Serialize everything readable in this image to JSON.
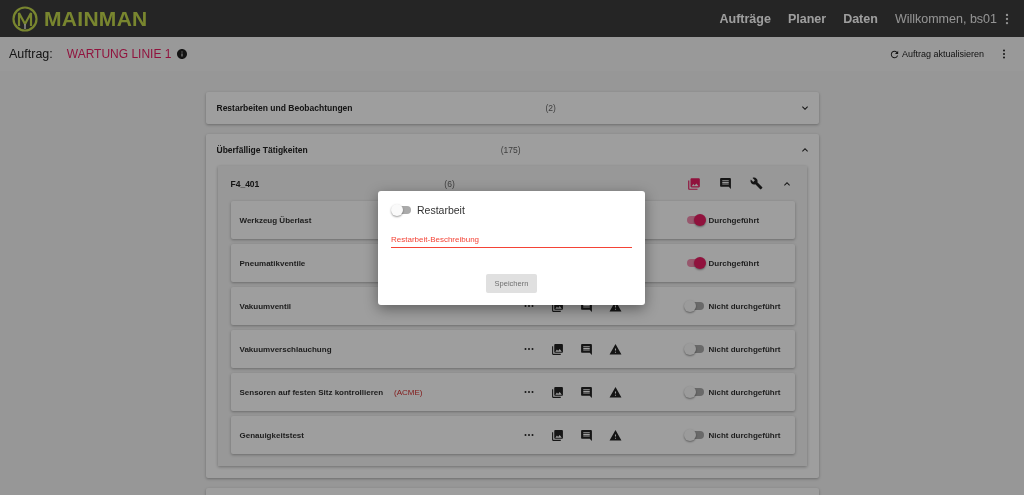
{
  "app": {
    "logo": "MAINMAN",
    "nav": [
      "Aufträge",
      "Planer",
      "Daten"
    ],
    "user": "Willkommen, bs01"
  },
  "order": {
    "label": "Auftrag:",
    "name": "WARTUNG LINIE 1",
    "refresh": "Auftrag aktualisieren"
  },
  "sections": [
    {
      "title": "Restarbeiten und Beobachtungen",
      "count": "(2)",
      "expanded": false
    },
    {
      "title": "Überfällige Tätigkeiten",
      "count": "(175)",
      "expanded": true,
      "groups": [
        {
          "title": "F4_401",
          "count": "(6)",
          "expanded": true,
          "photos_marked": true,
          "tasks": [
            {
              "name": "Werkzeug Überlast",
              "done": true,
              "status": "Durchgeführt"
            },
            {
              "name": "Pneumatikventile",
              "done": true,
              "status": "Durchgeführt"
            },
            {
              "name": "Vakuumventil",
              "done": false,
              "status": "Nicht durchgeführt"
            },
            {
              "name": "Vakuumverschlauchung",
              "done": false,
              "status": "Nicht durchgeführt"
            },
            {
              "name": "Sensoren auf festen Sitz kontrollieren",
              "tag": "(ACME)",
              "done": false,
              "status": "Nicht durchgeführt"
            },
            {
              "name": "Genauigkeitstest",
              "done": false,
              "status": "Nicht durchgeführt"
            }
          ]
        }
      ]
    }
  ],
  "dialog": {
    "title": "Restarbeit",
    "on": false,
    "placeholder": "Restarbeit-Beschreibung",
    "invalid": true,
    "button": "Speichern",
    "button_disabled": true
  }
}
